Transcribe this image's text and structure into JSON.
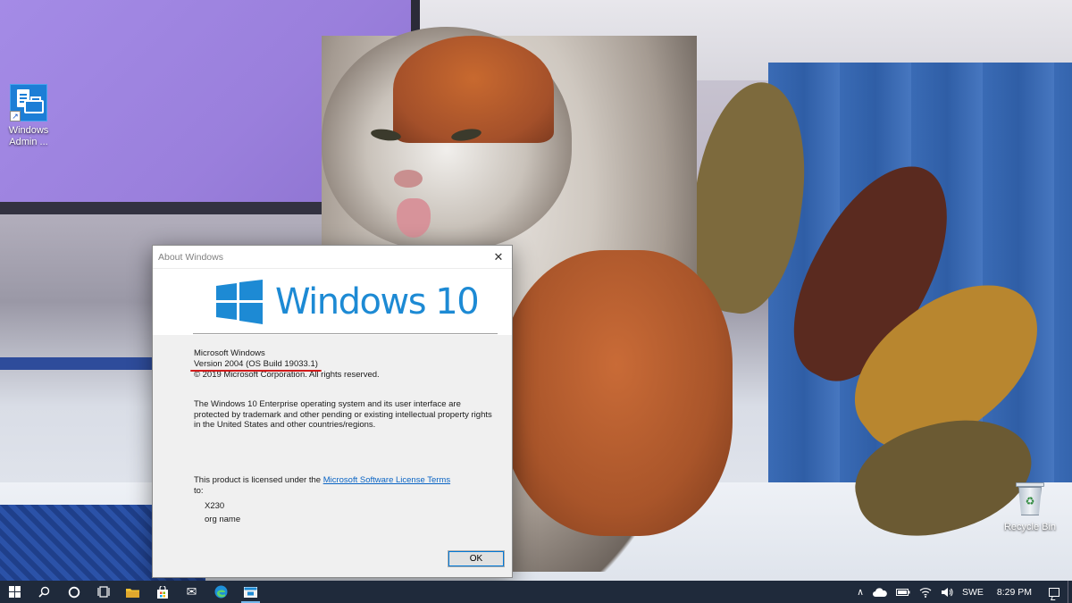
{
  "desktop": {
    "icons": [
      {
        "label": "Windows Admin ...",
        "icon": "windows-admin-center-icon"
      },
      {
        "label": "Recycle Bin",
        "icon": "recycle-bin-icon"
      }
    ]
  },
  "dialog": {
    "title": "About Windows",
    "close_glyph": "✕",
    "wordmark": "Windows 10",
    "product": "Microsoft Windows",
    "version": "Version 2004 (OS Build 19033.1)",
    "copyright": "© 2019 Microsoft Corporation. All rights reserved.",
    "legal": "The Windows 10 Enterprise operating system and its user interface are protected by trademark and other pending or existing intellectual property rights in the United States and other countries/regions.",
    "license_prefix": "This product is licensed under the ",
    "license_link": "Microsoft Software License Terms",
    "license_suffix": " to:",
    "licensed_user": "X230",
    "licensed_org": "org name",
    "ok_label": "OK",
    "colors": {
      "accent": "#1d8ad4",
      "link": "#0a64c4",
      "highlight": "#d11a1a"
    }
  },
  "taskbar": {
    "buttons": [
      {
        "icon": "start-icon"
      },
      {
        "icon": "search-icon",
        "glyph": "⚲"
      },
      {
        "icon": "cortana-icon",
        "glyph": "○"
      },
      {
        "icon": "task-view-icon",
        "glyph": "⧉"
      },
      {
        "icon": "file-explorer-icon"
      },
      {
        "icon": "store-icon"
      },
      {
        "icon": "mail-icon",
        "glyph": "✉"
      },
      {
        "icon": "edge-icon"
      },
      {
        "icon": "about-windows-icon"
      }
    ],
    "tray": {
      "chevron": "∧",
      "language": "SWE",
      "time": "8:29 PM"
    }
  }
}
